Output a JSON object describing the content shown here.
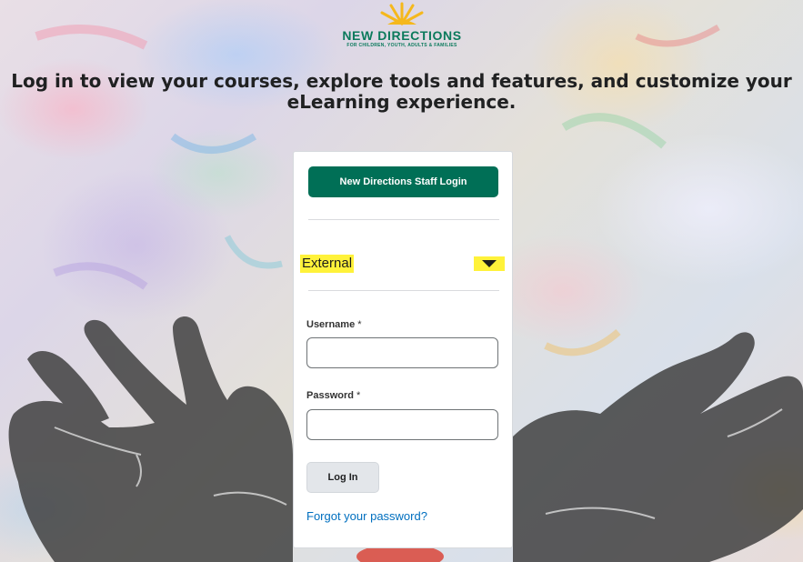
{
  "brand": {
    "name": "NEW DIRECTIONS",
    "tagline": "FOR CHILDREN, YOUTH, ADULTS & FAMILIES"
  },
  "headline": "Log in to view your courses, explore tools and features, and customize your eLearning experience.",
  "login_card": {
    "staff_login_label": "New Directions Staff Login",
    "account_type": {
      "selected": "External",
      "highlight_color": "#fff23a"
    },
    "username": {
      "label": "Username",
      "required_marker": "*",
      "value": ""
    },
    "password": {
      "label": "Password",
      "required_marker": "*",
      "value": ""
    },
    "login_label": "Log In",
    "forgot_label": "Forgot your password?"
  },
  "colors": {
    "brand_green": "#006f56",
    "link_blue": "#006fbf"
  },
  "icons": {
    "sun_logo": "sun-logo-icon",
    "dropdown": "caret-down-icon"
  }
}
